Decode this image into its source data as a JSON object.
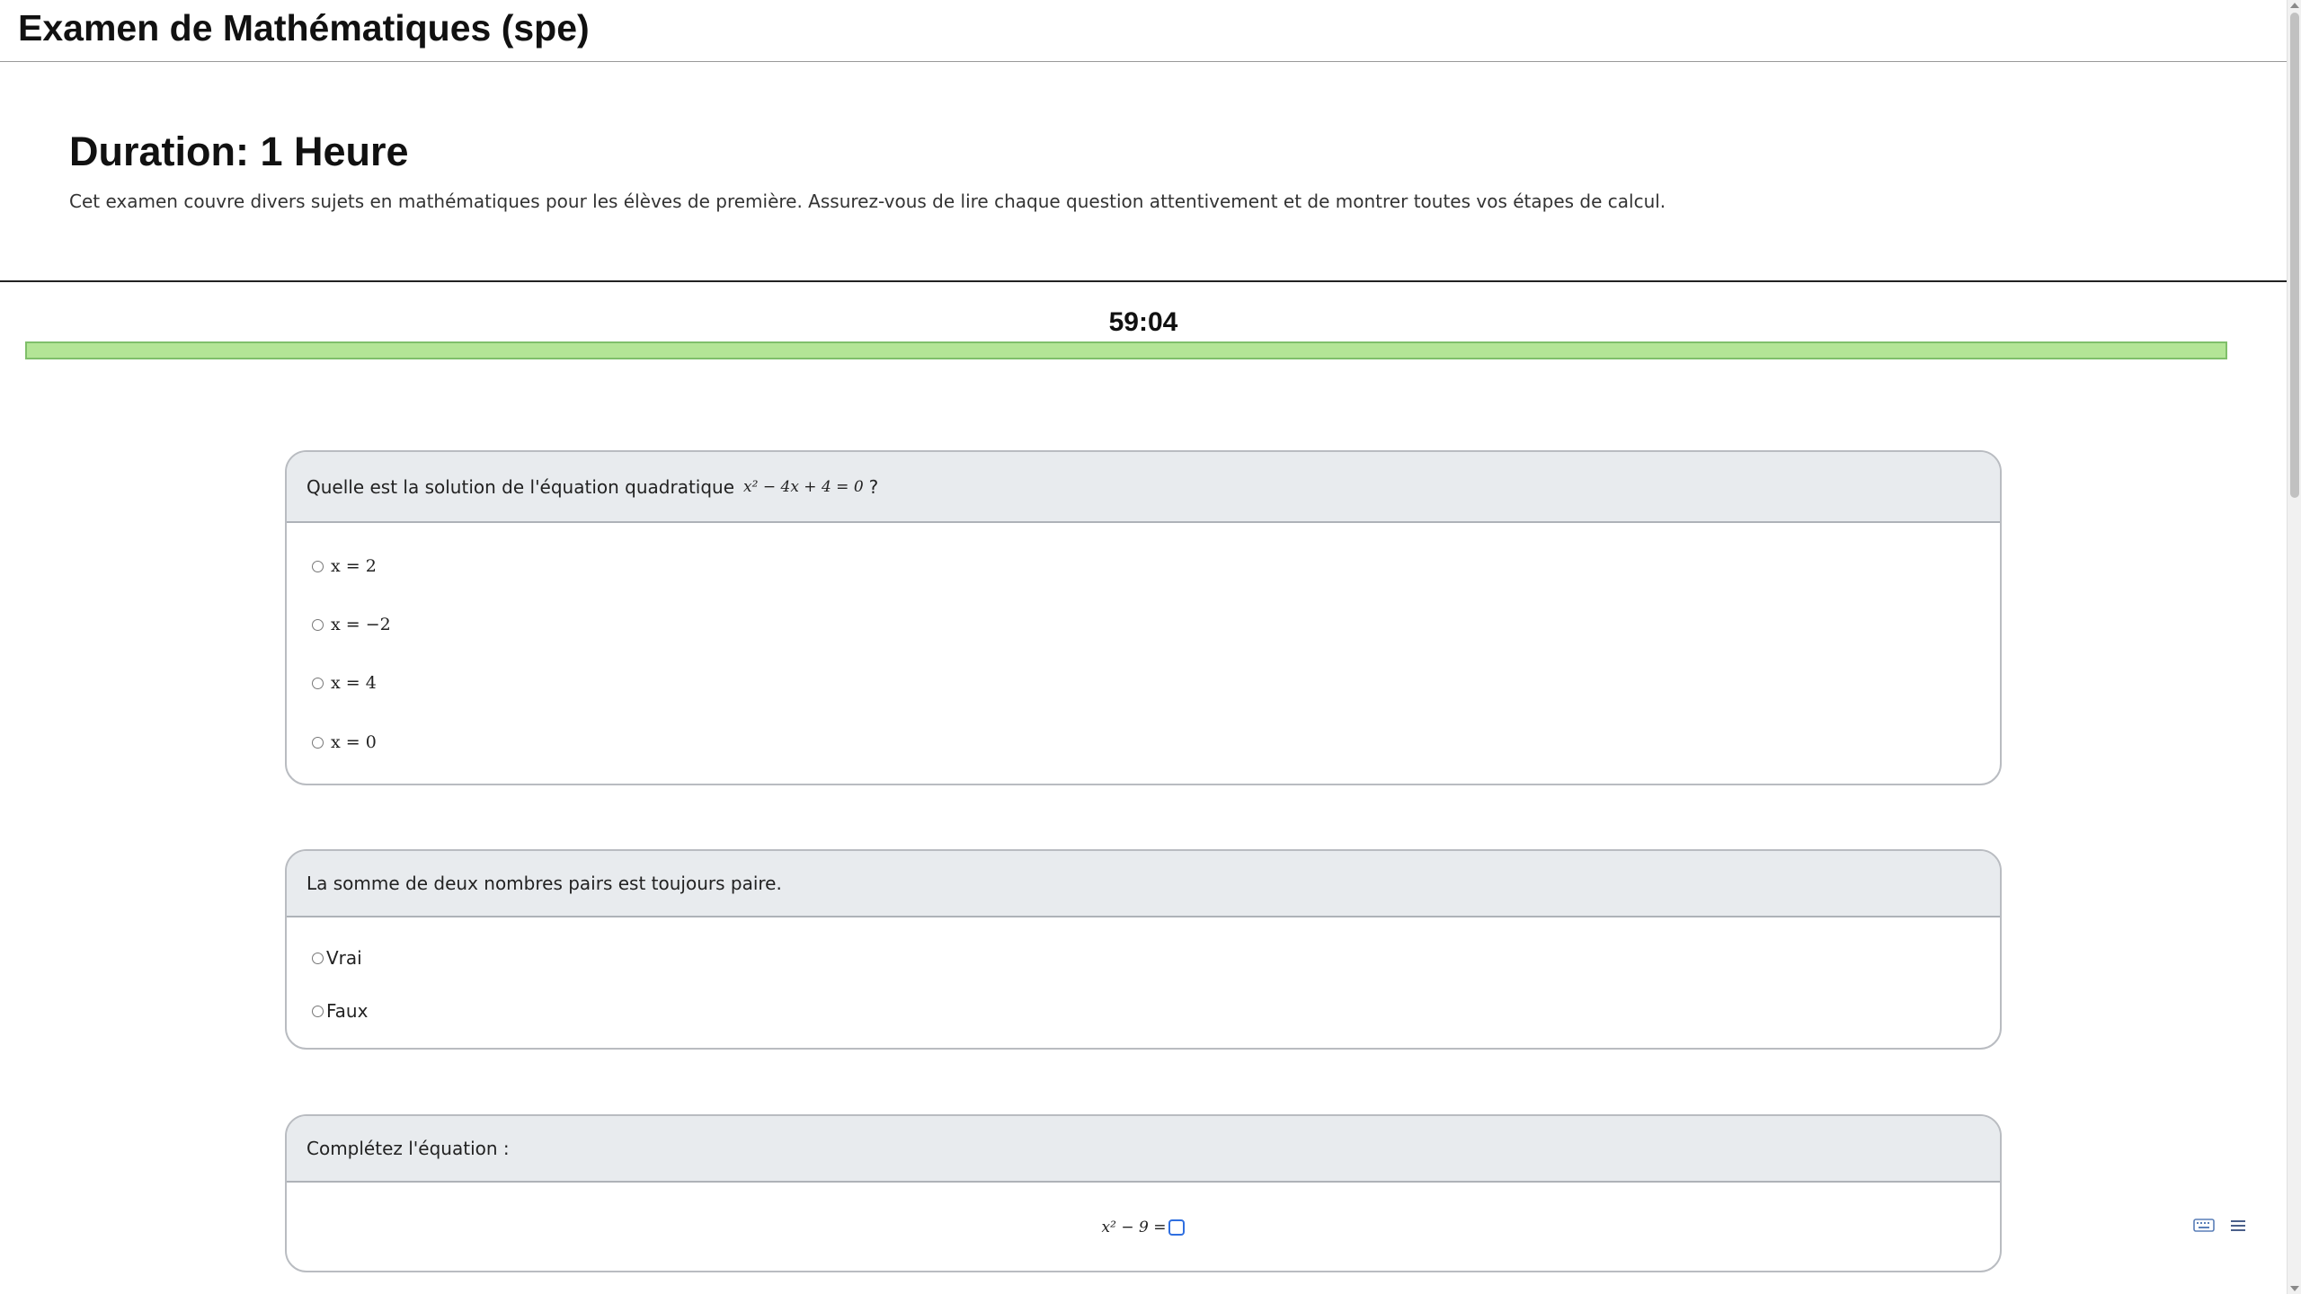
{
  "header": {
    "title": "Examen de Mathématiques (spe)"
  },
  "intro": {
    "duration": "Duration: 1 Heure",
    "description": "Cet examen couvre divers sujets en mathématiques pour les élèves de première. Assurez-vous de lire chaque question attentivement et de montrer toutes vos étapes de calcul."
  },
  "timer": {
    "display": "59:04",
    "remaining_fraction": 1.0,
    "bar_color": "#b3e596"
  },
  "questions": [
    {
      "prompt_prefix": "Quelle est la solution de l'équation quadratique",
      "prompt_math": "x² − 4x + 4 = 0",
      "prompt_suffix": "?",
      "options": [
        "x = 2",
        "x = −2",
        "x = 4",
        "x = 0"
      ]
    },
    {
      "prompt": "La somme de deux nombres pairs est toujours paire.",
      "options": [
        "Vrai",
        "Faux"
      ]
    },
    {
      "prompt": "Complétez l'équation :",
      "equation": "x² − 9 =",
      "icons": [
        "keyboard-icon",
        "menu-icon"
      ]
    }
  ],
  "colors": {
    "card_header": "#e8ebee",
    "accent_blue": "#2f6fe0"
  }
}
